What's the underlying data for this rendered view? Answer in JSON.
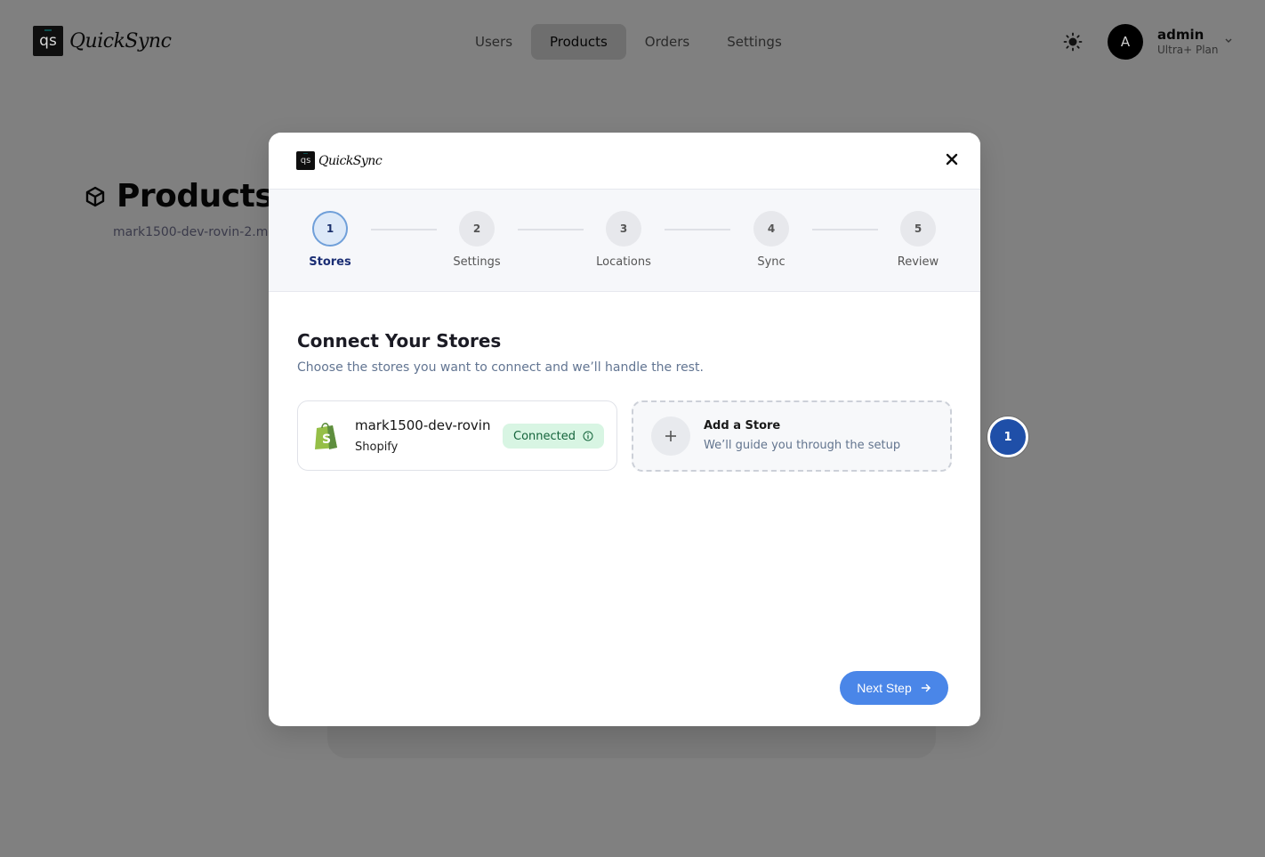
{
  "brand": {
    "logo_mark": "qs",
    "logo_word": "QuickSync"
  },
  "nav": {
    "items": [
      {
        "label": "Users"
      },
      {
        "label": "Products"
      },
      {
        "label": "Orders"
      },
      {
        "label": "Settings"
      }
    ],
    "active": "Products"
  },
  "user": {
    "avatar_initial": "A",
    "name": "admin",
    "plan": "Ultra+ Plan"
  },
  "page": {
    "title": "Products",
    "subtitle": "mark1500-dev-rovin-2.m"
  },
  "modal": {
    "steps": [
      {
        "number": "1",
        "label": "Stores"
      },
      {
        "number": "2",
        "label": "Settings"
      },
      {
        "number": "3",
        "label": "Locations"
      },
      {
        "number": "4",
        "label": "Sync"
      },
      {
        "number": "5",
        "label": "Review"
      }
    ],
    "active_step": "1",
    "heading": "Connect Your Stores",
    "subheading": "Choose the stores you want to connect and we’ll handle the rest.",
    "store": {
      "name": "mark1500-dev-rovin",
      "platform": "Shopify",
      "status": "Connected",
      "status_color": "#14643b"
    },
    "add_store": {
      "title": "Add a Store",
      "subtitle": "We’ll guide you through the setup"
    },
    "next_button": "Next Step",
    "accent_color": "#4a86e8"
  },
  "marker": {
    "label": "1"
  }
}
